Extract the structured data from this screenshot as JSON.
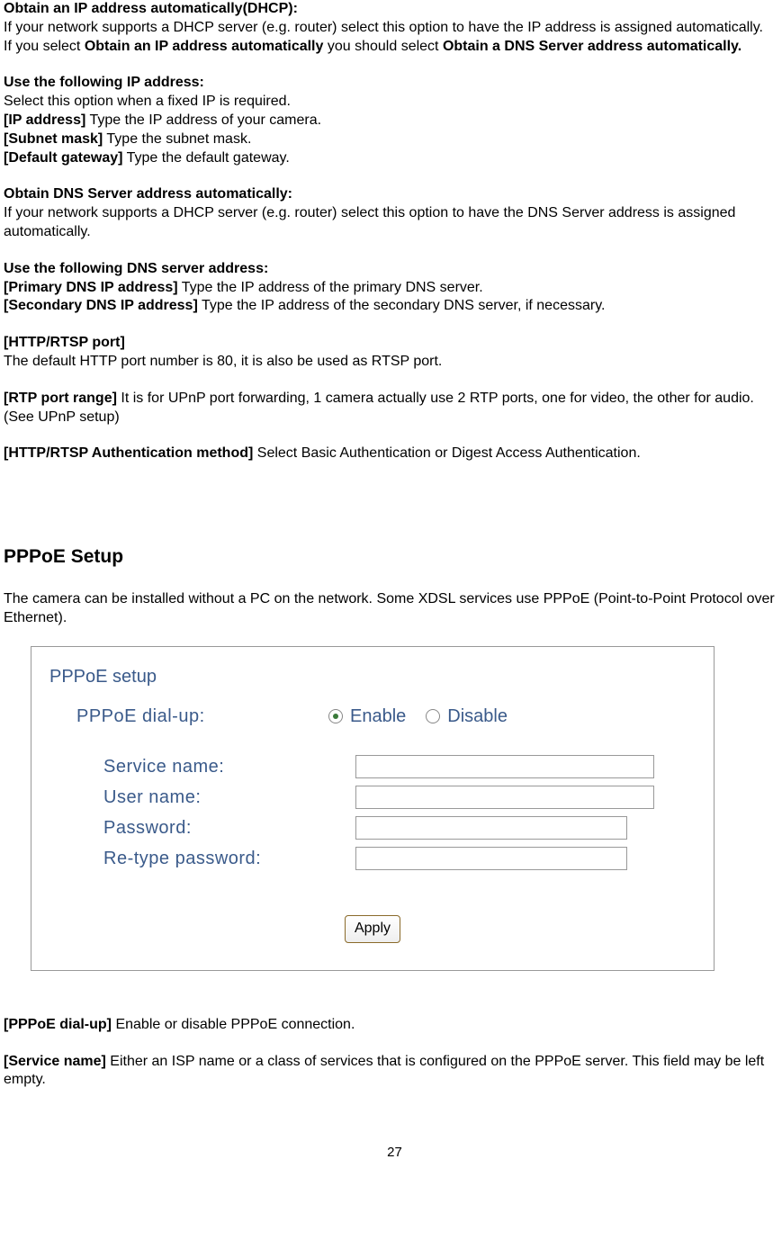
{
  "s1": {
    "h": "Obtain an IP address automatically(DHCP):",
    "t1": "If your network supports a DHCP server (e.g. router) select this option to have the IP address is assigned automatically.",
    "t2a": "If you select ",
    "t2b": "Obtain an IP address automatically",
    "t2c": " you should select ",
    "t2d": "Obtain a DNS Server address automatically."
  },
  "s2": {
    "h": "Use the following IP address:",
    "t1": "Select this option when a fixed IP is required.",
    "b1": "[IP address]",
    "d1": " Type the IP address of your camera.",
    "b2": "[Subnet mask]",
    "d2": " Type the subnet mask.",
    "b3": "[Default gateway]",
    "d3": " Type the default gateway."
  },
  "s3": {
    "h": "Obtain DNS Server address automatically:",
    "t1": "If your network supports a DHCP server (e.g. router) select this option to have the DNS Server address is assigned automatically."
  },
  "s4": {
    "h": "Use the following DNS server address:",
    "b1": "[Primary DNS IP address]",
    "d1": " Type the IP address of the primary DNS server.",
    "b2": "[Secondary DNS IP address]",
    "d2": " Type the IP address of the secondary DNS server, if necessary."
  },
  "s5": {
    "h": "[HTTP/RTSP port]",
    "t1": "The default HTTP port number is 80, it is also be used as RTSP port."
  },
  "s6": {
    "b": "[RTP port range]",
    "t": " It is for UPnP port forwarding, 1 camera actually use 2 RTP ports, one for video, the other for audio. (See UPnP setup)"
  },
  "s7": {
    "b": "[HTTP/RTSP Authentication method]",
    "t": " Select Basic Authentication or Digest Access Authentication."
  },
  "pppoe_heading": "PPPoE Setup",
  "pppoe_intro": "The camera can be installed without a PC on the network. Some XDSL services use PPPoE (Point-to-Point Protocol over Ethernet).",
  "box": {
    "title": "PPPoE setup",
    "dialup_label": "PPPoE dial-up:",
    "enable": "Enable",
    "disable": "Disable",
    "service": "Service name:",
    "user": "User name:",
    "password": "Password:",
    "retype": "Re-type password:",
    "apply": "Apply"
  },
  "s8": {
    "b": "[PPPoE dial-up]",
    "t": " Enable or disable PPPoE connection."
  },
  "s9": {
    "b": "[Service name]",
    "t": " Either an ISP name or a class of services that is configured on the PPPoE server. This field may be left empty."
  },
  "page": "27"
}
